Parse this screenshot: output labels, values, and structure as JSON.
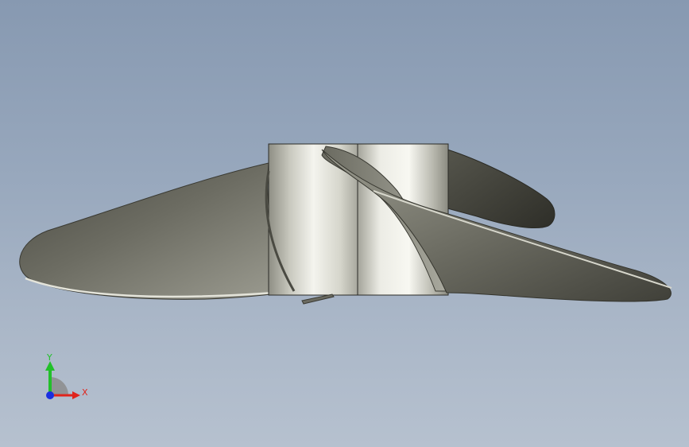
{
  "viewport": {
    "background_top": "#8799b1",
    "background_bottom": "#b6c1cf"
  },
  "model": {
    "type": "3D propeller (side view)",
    "hub_color": "#d9d9cf",
    "blade_color": "#7b7b70"
  },
  "triad": {
    "y_label": "Y",
    "x_label": "X",
    "y_color": "#22c02a",
    "x_color": "#e0241c",
    "z_color": "#1a2fe0"
  }
}
